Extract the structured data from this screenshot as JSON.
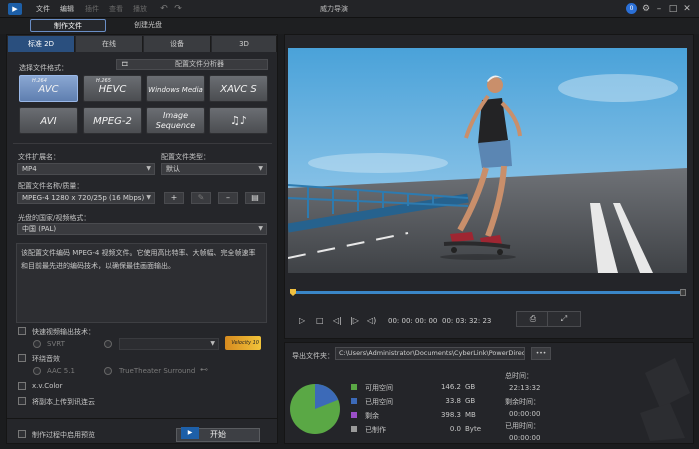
{
  "titlebar": {
    "logo": "▶",
    "menus": [
      "文件",
      "编辑",
      "插件",
      "查看",
      "播放"
    ],
    "title": "威力导演",
    "notification_count": "0"
  },
  "subtabs": [
    "制作文件",
    "创建光盘"
  ],
  "main_tabs": [
    "标准 2D",
    "在线",
    "设备",
    "3D"
  ],
  "format_section": {
    "label": "选择文件格式：",
    "profile_analyzer": "配置文件分析器",
    "formats": [
      {
        "sup": "H.264",
        "name": "AVC"
      },
      {
        "sup": "H.265",
        "name": "HEVC"
      },
      {
        "sup": "",
        "name": "Windows Media"
      },
      {
        "sup": "",
        "name": "XAVC S"
      },
      {
        "sup": "",
        "name": "AVI"
      },
      {
        "sup": "",
        "name": "MPEG-2"
      },
      {
        "sup": "",
        "name": "Image Sequence"
      },
      {
        "sup": "",
        "name": "♫♪"
      }
    ]
  },
  "file_ext": {
    "label": "文件扩展名：",
    "value": "MP4"
  },
  "profile_type": {
    "label": "配置文件类型：",
    "value": "默认"
  },
  "profile_name": {
    "label": "配置文件名称/质量：",
    "value": "MPEG-4 1280 x 720/25p (16 Mbps)"
  },
  "region": {
    "label": "光盘的国家/视频格式：",
    "value": "中国 (PAL)"
  },
  "description": "该配置文件编码 MPEG-4 视频文件。它使用高比特率、大帧幅、完全帧速率和目前最先进的编码技术，以确保最佳画面输出。",
  "options": {
    "fast_render": "快速视频输出技术：",
    "svrt": "SVRT",
    "velocity": "Velocity 10",
    "surround": "环绕音效",
    "aac": "AAC 5.1",
    "truetheater": "TrueTheater Surround",
    "xvcolor": "x.v.Color",
    "upload": "将副本上传到讯连云",
    "preview_enable": "制作过程中启用预览",
    "start": "开始"
  },
  "player": {
    "time_current": "00: 00: 00: 00",
    "time_total": "00: 03: 32: 23",
    "progress": 1.0
  },
  "export": {
    "label": "导出文件夹：",
    "path": "C:\\Users\\Administrator\\Documents\\CyberLink\\PowerDirector",
    "browse": "•••"
  },
  "storage": {
    "items": [
      {
        "label": "可用空间",
        "value": "146.2",
        "unit": "GB",
        "color": "#5aa845"
      },
      {
        "label": "已用空间",
        "value": "33.8",
        "unit": "GB",
        "color": "#3c6ab8"
      },
      {
        "label": "剩余",
        "value": "398.3",
        "unit": "MB",
        "color": "#9b4fc9"
      },
      {
        "label": "已制作",
        "value": "0.0",
        "unit": "Byte",
        "color": "#9a9a9a"
      }
    ],
    "free_fraction": 0.81
  },
  "times": {
    "total_label": "总时间：",
    "total_value": "22:13:32",
    "remaining_label": "剩余时间：",
    "remaining_value": "00:00:00",
    "elapsed_label": "已用时间：",
    "elapsed_value": "00:00:00"
  }
}
